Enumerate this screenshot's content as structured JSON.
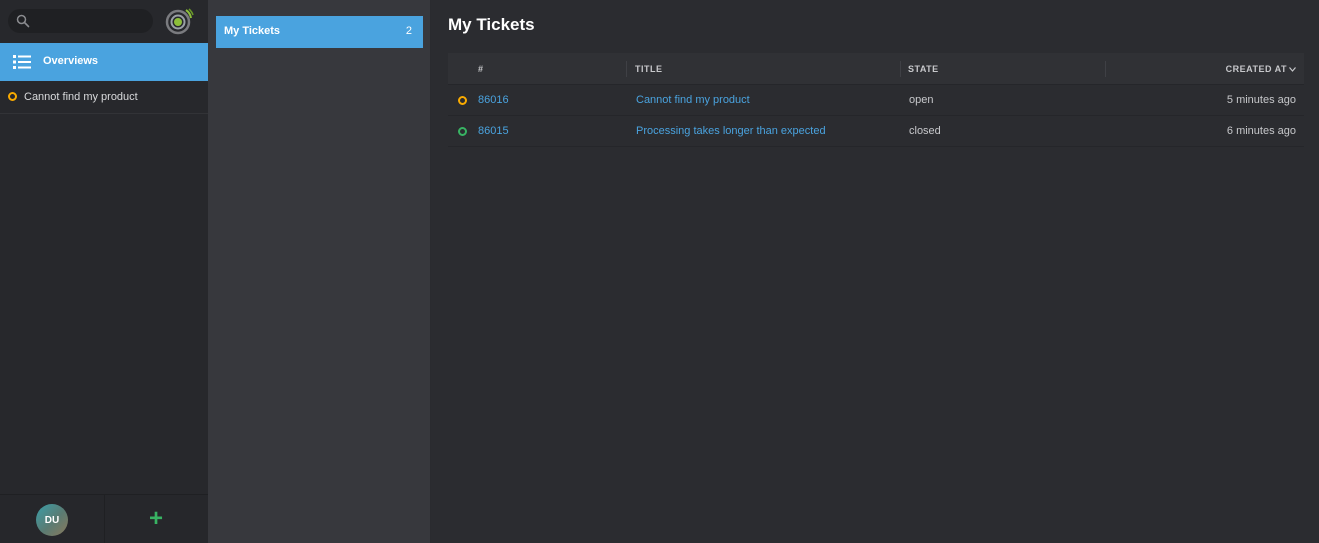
{
  "search": {
    "placeholder": "",
    "value": ""
  },
  "colors": {
    "accent": "#4aa3df",
    "status_open": "#faab00",
    "status_closed": "#38b363",
    "add": "#38b363"
  },
  "nav": {
    "overviews_label": "Overviews",
    "recent_ticket_label": "Cannot find my product",
    "avatar_initials": "DU",
    "add_symbol": "+"
  },
  "overviews": {
    "items": [
      {
        "label": "My Tickets",
        "count": "2"
      }
    ]
  },
  "main": {
    "title": "My Tickets",
    "columns": {
      "number": "#",
      "title": "TITLE",
      "state": "STATE",
      "created": "CREATED AT"
    },
    "rows": [
      {
        "number": "86016",
        "title": "Cannot find my product",
        "state": "open",
        "created": "5 minutes ago",
        "status": "open"
      },
      {
        "number": "86015",
        "title": "Processing takes longer than expected",
        "state": "closed",
        "created": "6 minutes ago",
        "status": "closed"
      }
    ]
  }
}
